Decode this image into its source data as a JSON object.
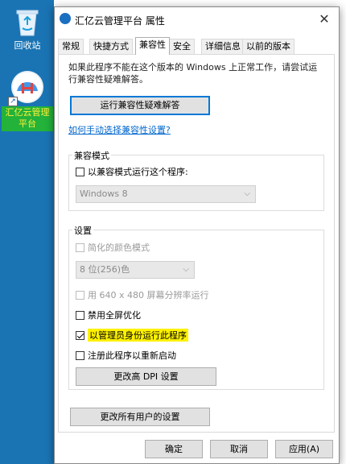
{
  "desktop": {
    "recycle_label": "回收站",
    "app_label": "汇亿云管理平台"
  },
  "window": {
    "title": "汇亿云管理平台 属性",
    "close_symbol": "✕"
  },
  "tabs": [
    "常规",
    "快捷方式",
    "兼容性",
    "安全",
    "详细信息",
    "以前的版本"
  ],
  "intro_text": "如果此程序不能在这个版本的 Windows 上正常工作，请尝试运行兼容性疑难解答。",
  "troubleshoot_button": "运行兼容性疑难解答",
  "manual_link": "如何手动选择兼容性设置?",
  "compat_mode": {
    "group_title": "兼容模式",
    "checkbox_label": "以兼容模式运行这个程序:",
    "select_value": "Windows 8"
  },
  "settings": {
    "group_title": "设置",
    "reduced_color_label": "简化的颜色模式",
    "color_select_value": "8 位(256)色",
    "res_640_label": "用 640 x 480 屏幕分辨率运行",
    "disable_fullscreen_label": "禁用全屏优化",
    "run_as_admin_label": "以管理员身份运行此程序",
    "register_restart_label": "注册此程序以重新启动",
    "dpi_button": "更改高 DPI 设置"
  },
  "all_users_button": "更改所有用户的设置",
  "footer": {
    "ok": "确定",
    "cancel": "取消",
    "apply": "应用(A)"
  },
  "colors": {
    "desktop_bg": "#1a74b4",
    "highlight": "#fff200",
    "focus": "#0078d7",
    "link": "#0066cc"
  }
}
